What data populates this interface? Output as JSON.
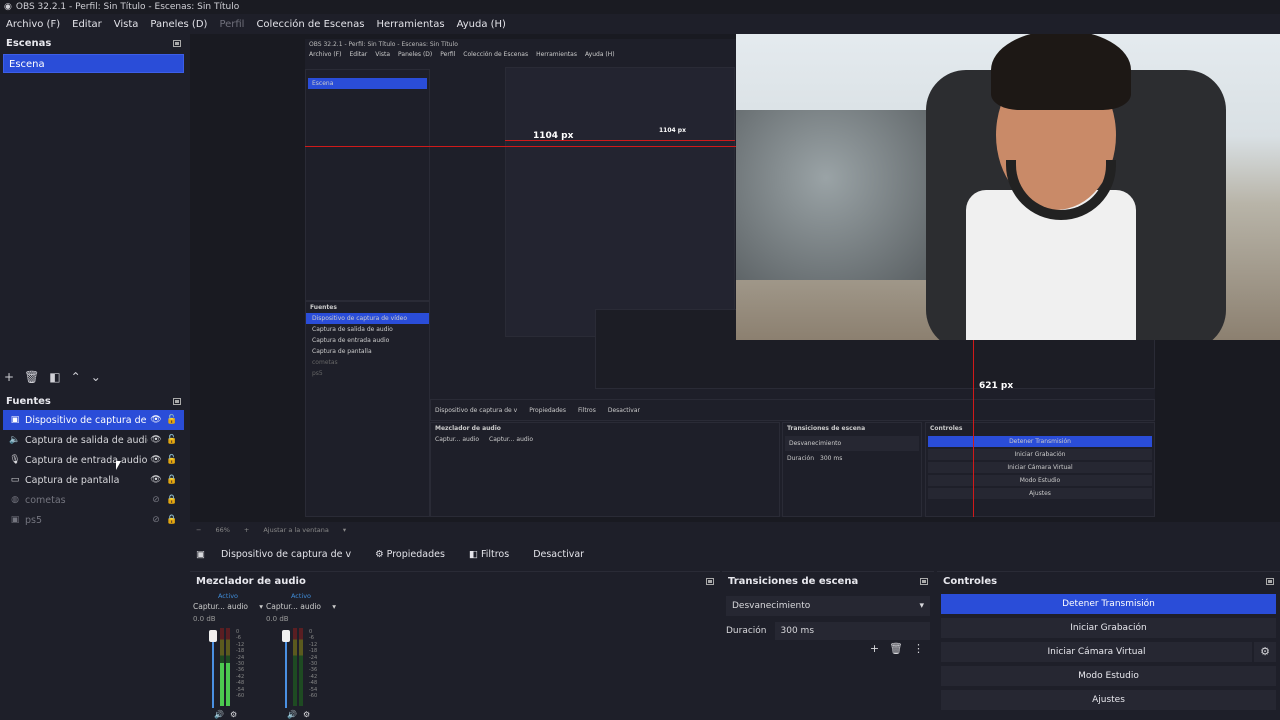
{
  "window": {
    "title": "OBS 32.2.1 - Perfil: Sin Título - Escenas: Sin Título"
  },
  "menu": [
    {
      "label": "Archivo (F)",
      "dim": false
    },
    {
      "label": "Editar",
      "dim": false
    },
    {
      "label": "Vista",
      "dim": false
    },
    {
      "label": "Paneles (D)",
      "dim": false
    },
    {
      "label": "Perfil",
      "dim": true
    },
    {
      "label": "Colección de Escenas",
      "dim": false
    },
    {
      "label": "Herramientas",
      "dim": false
    },
    {
      "label": "Ayuda (H)",
      "dim": false
    }
  ],
  "scenes": {
    "title": "Escenas",
    "items": [
      "Escena"
    ],
    "selected": 0
  },
  "sources": {
    "title": "Fuentes",
    "items": [
      {
        "icon": "camera-icon",
        "label": "Dispositivo de captura de vídeo",
        "selected": true,
        "dim": false
      },
      {
        "icon": "speaker-icon",
        "label": "Captura de salida de audio",
        "selected": false,
        "dim": false
      },
      {
        "icon": "microphone-icon",
        "label": "Captura de entrada audio",
        "selected": false,
        "dim": false
      },
      {
        "icon": "monitor-icon",
        "label": "Captura de pantalla",
        "selected": false,
        "dim": false
      },
      {
        "icon": "globe-icon",
        "label": "cometas",
        "selected": false,
        "dim": true
      },
      {
        "icon": "camera-icon",
        "label": "ps5",
        "selected": false,
        "dim": true
      }
    ]
  },
  "preview": {
    "nested_title": "OBS 32.2.1 - Perfil: Sin Título - Escenas: Sin Título",
    "nested_menu": [
      "Archivo (F)",
      "Editar",
      "Vista",
      "Paneles (D)",
      "Perfil",
      "Colección de Escenas",
      "Herramientas",
      "Ayuda (H)"
    ],
    "nested_scene": "Escena",
    "nested_sources_title": "Fuentes",
    "nested_sources": [
      "Dispositivo de captura de vídeo",
      "Captura de salida de audio",
      "Captura de entrada audio",
      "Captura de pantalla",
      "cometas",
      "ps5"
    ],
    "measure_top": "1104 px",
    "measure_top_inner": "1104 px",
    "measure_side": "621 px",
    "nested_toolbar": [
      "Dispositivo de captura de v",
      "Propiedades",
      "Filtros",
      "Desactivar"
    ],
    "nested_docks": [
      "Mezclador de audio",
      "Transiciones de escena",
      "Controles"
    ],
    "nested_transition": "Desvanecimiento",
    "nested_duration_label": "Duración",
    "nested_duration": "300 ms",
    "nested_controls": [
      "Detener Transmisión",
      "Iniciar Grabación",
      "Iniciar Cámara Virtual",
      "Modo Estudio",
      "Ajustes"
    ],
    "nested_channels": [
      "Captur... audio",
      "Captur... audio"
    ]
  },
  "zoom": {
    "minus": "−",
    "value": "66%",
    "plus": "+",
    "fit": "Ajustar a la ventana"
  },
  "source_toolbar": {
    "name": "Dispositivo de captura de v",
    "properties": "Propiedades",
    "filters": "Filtros",
    "deactivate": "Desactivar"
  },
  "mixer": {
    "title": "Mezclador de audio",
    "channels": [
      {
        "status": "Activo",
        "name": "Captur... audio",
        "db": "0.0 dB",
        "level": 0.55
      },
      {
        "status": "Activo",
        "name": "Captur... audio",
        "db": "0.0 dB",
        "level": 0.0
      }
    ],
    "scale": [
      "0",
      "-6",
      "-12",
      "-18",
      "-24",
      "-30",
      "-36",
      "-42",
      "-48",
      "-54",
      "-60"
    ]
  },
  "transitions": {
    "title": "Transiciones de escena",
    "selected": "Desvanecimiento",
    "duration_label": "Duración",
    "duration": "300 ms"
  },
  "controls": {
    "title": "Controles",
    "stream": "Detener Transmisión",
    "record": "Iniciar Grabación",
    "virtualcam": "Iniciar Cámara Virtual",
    "studio": "Modo Estudio",
    "settings": "Ajustes"
  },
  "colors": {
    "accent": "#2a4dd8",
    "bg": "#1e1f29",
    "measure": "#d01a1a"
  }
}
